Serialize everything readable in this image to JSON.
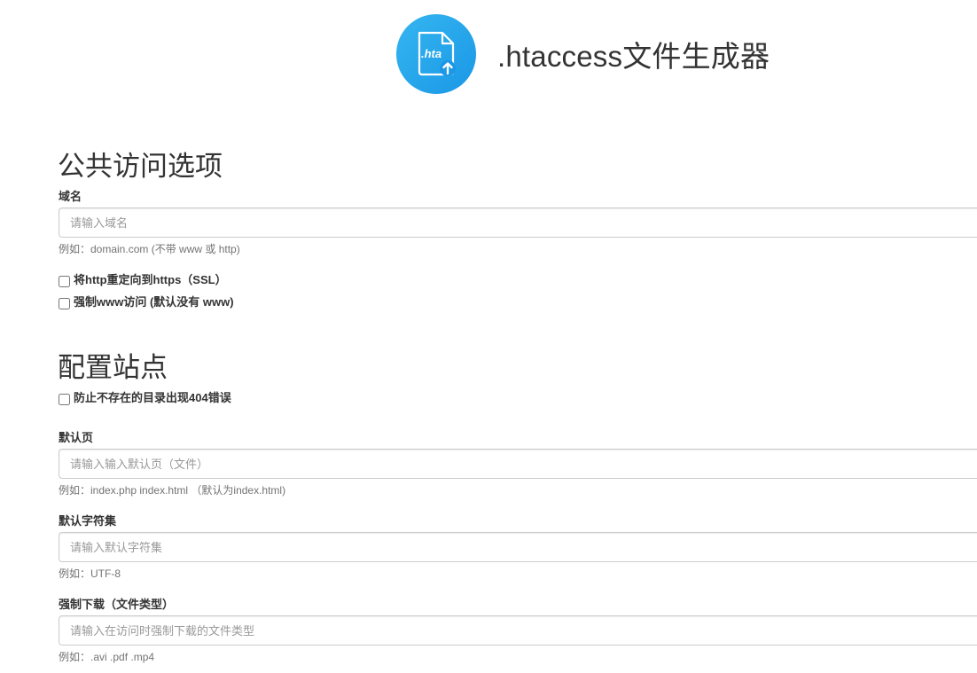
{
  "header": {
    "logo_text": ".hta",
    "title": ".htaccess文件生成器"
  },
  "public_section": {
    "title": "公共访问选项",
    "domain": {
      "label": "域名",
      "placeholder": "请输入域名",
      "value": "",
      "help": "例如：domain.com (不带 www 或 http)"
    },
    "checkboxes": [
      {
        "label": "将http重定向到https（SSL）",
        "checked": false
      },
      {
        "label": "强制www访问 (默认没有 www)",
        "checked": false
      }
    ]
  },
  "site_section": {
    "title": "配置站点",
    "prevent_404": {
      "label": "防止不存在的目录出现404错误",
      "checked": false
    },
    "default_page": {
      "label": "默认页",
      "placeholder": "请输入输入默认页（文件）",
      "value": "",
      "help": "例如：index.php index.html （默认为index.html)"
    },
    "default_charset": {
      "label": "默认字符集",
      "placeholder": "请输入默认字符集",
      "value": "",
      "help": "例如：UTF-8"
    },
    "force_download": {
      "label": "强制下载（文件类型）",
      "placeholder": "请输入在访问时强制下载的文件类型",
      "value": "",
      "help": "例如：.avi .pdf .mp4"
    }
  },
  "colors": {
    "logo_gradient_start": "#35b6f0",
    "logo_gradient_end": "#1a97e6",
    "text": "#333333",
    "help_text": "#737373",
    "input_border": "#cccccc"
  }
}
